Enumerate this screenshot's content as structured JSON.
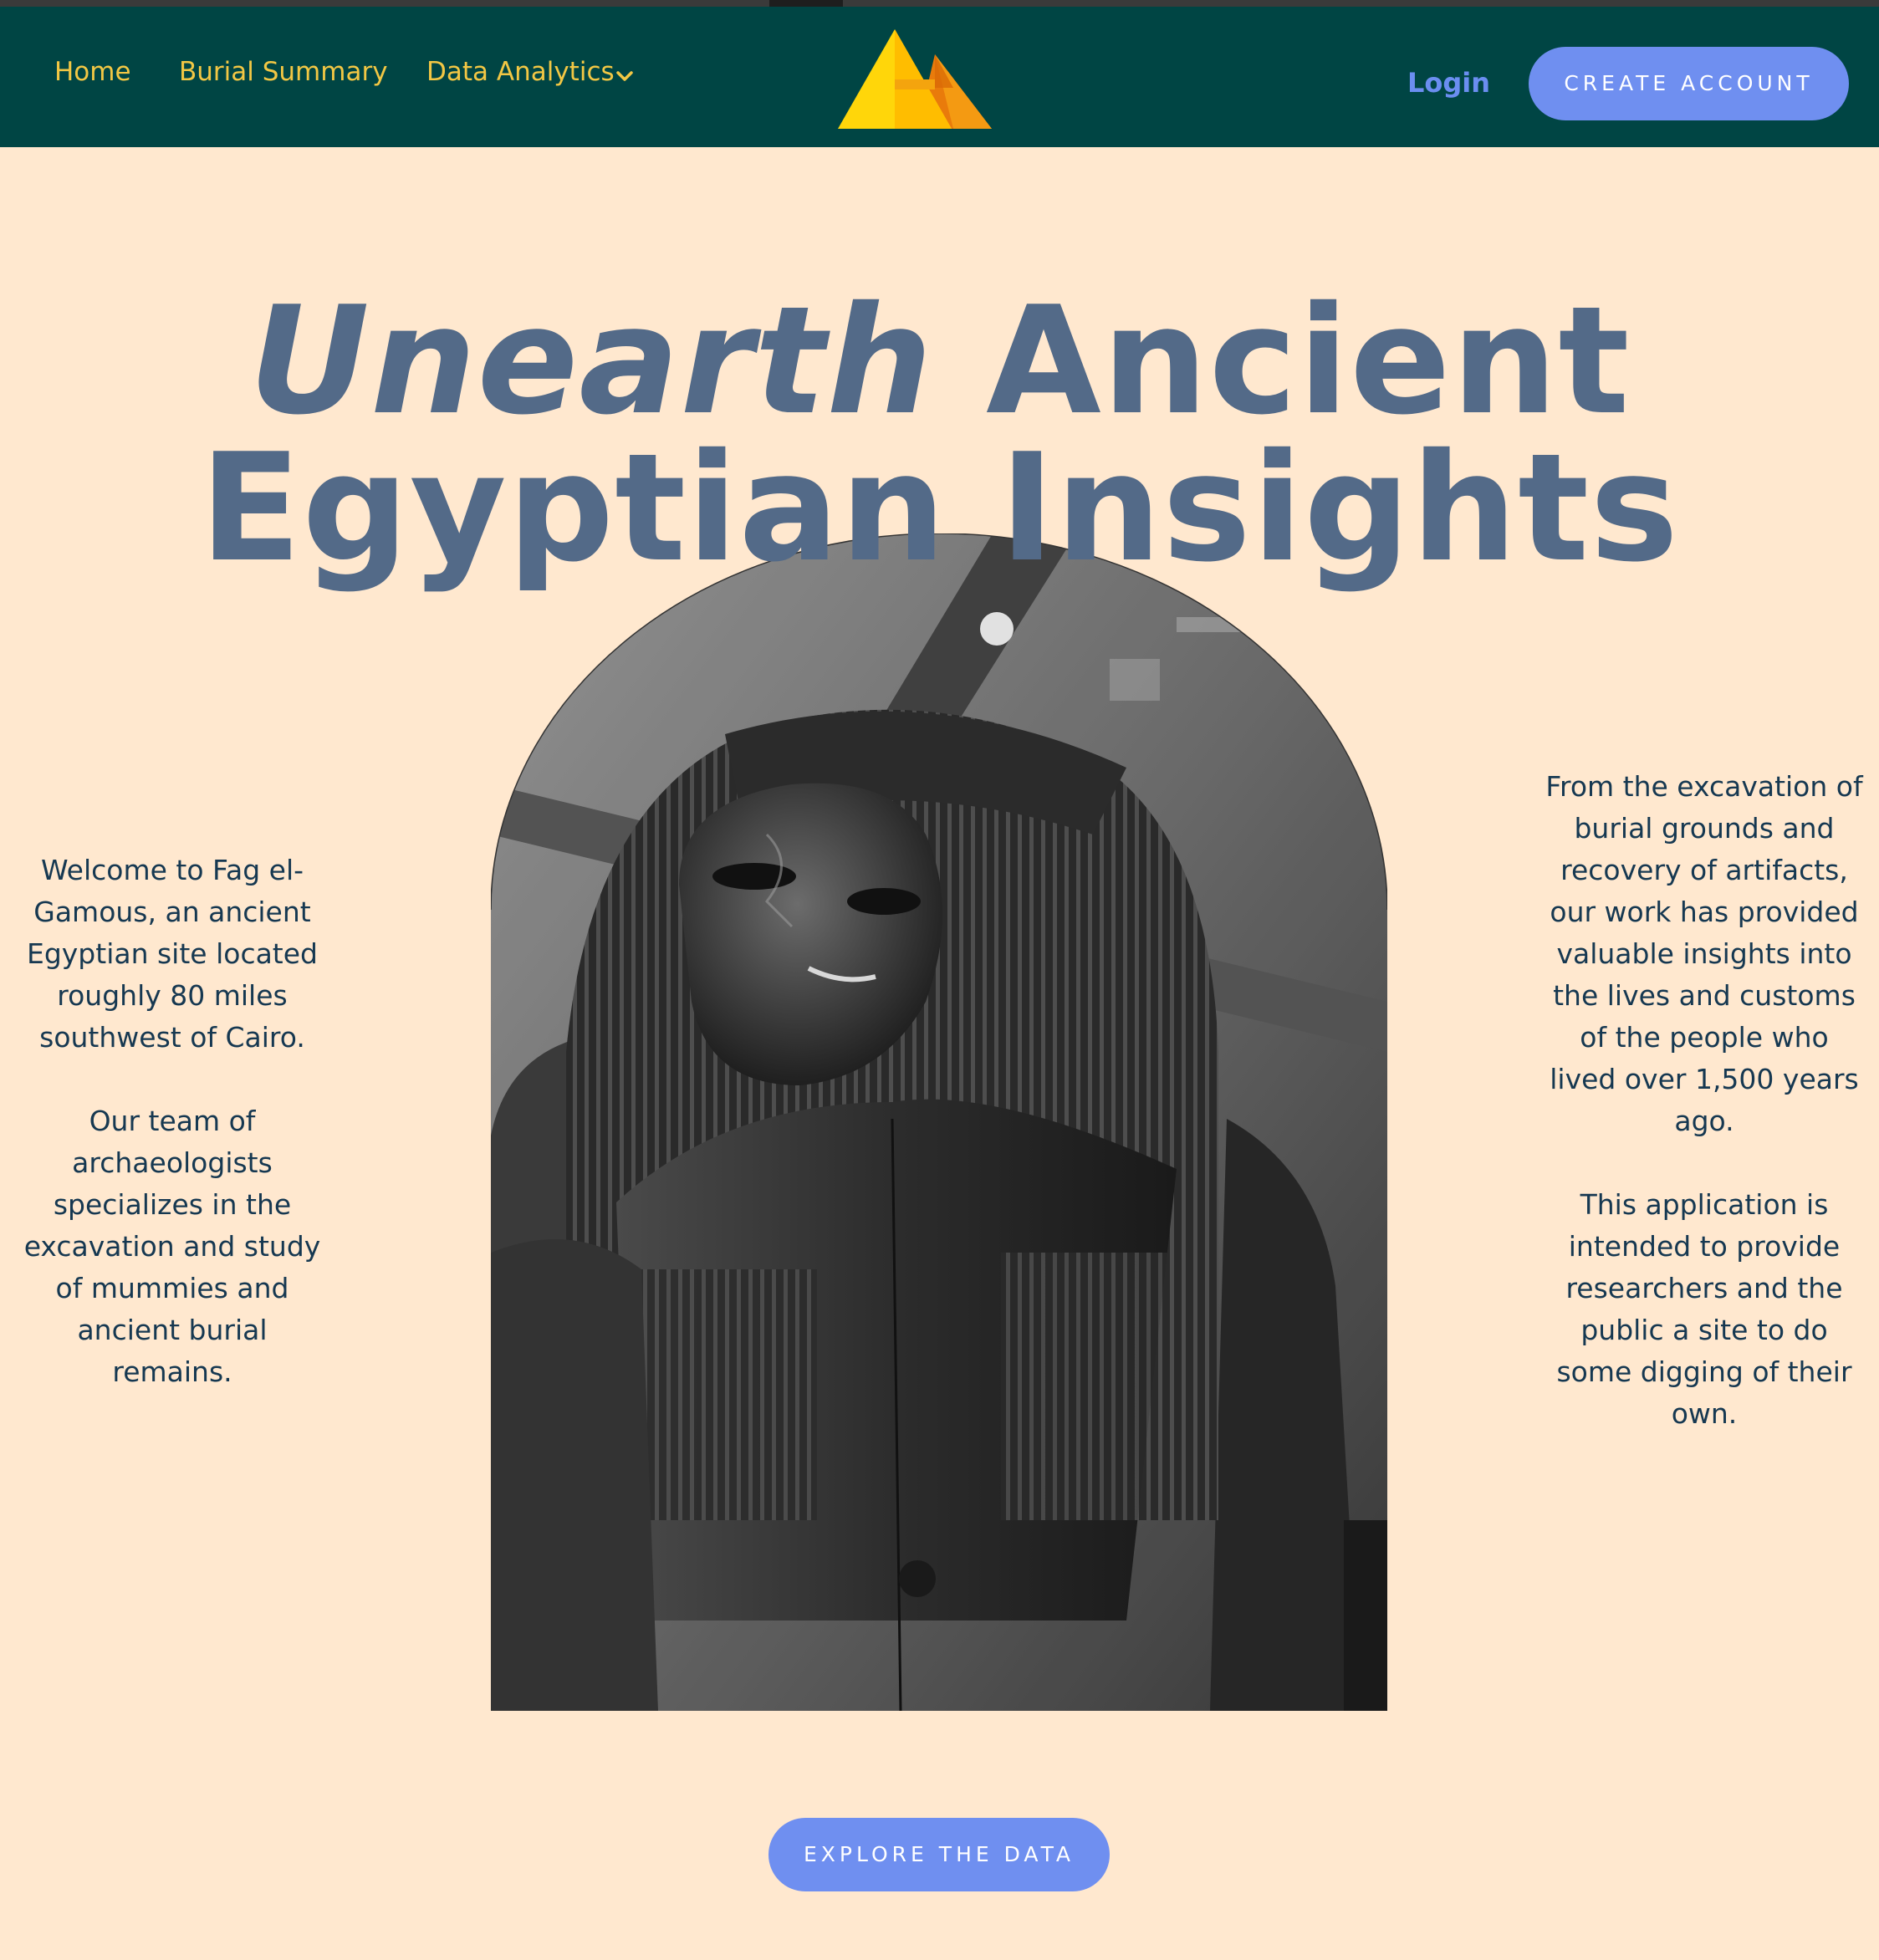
{
  "nav": {
    "home": "Home",
    "burial_summary": "Burial Summary",
    "data_analytics": "Data Analytics",
    "login": "Login",
    "create_account": "CREATE ACCOUNT"
  },
  "logo": {
    "icon": "pyramids-logo-icon",
    "colors": [
      "#ffd60a",
      "#ffbd00",
      "#f48c06",
      "#e85d04"
    ]
  },
  "hero": {
    "headline_italic": "Unearth",
    "headline_rest_line1": "Ancient",
    "headline_line2": "Egyptian Insights",
    "image": "sarcophagus-photo"
  },
  "left_column": {
    "paragraph1": "Welcome to Fag el-Gamous, an ancient Egyptian site located roughly 80 miles southwest of Cairo.",
    "paragraph2": "Our team of archaeologists specializes in the excavation and study of mummies and ancient burial remains."
  },
  "right_column": {
    "paragraph1": "From the excavation of burial grounds and recovery of artifacts, our work has provided valuable insights into the lives and customs of the people who lived over 1,500 years ago.",
    "paragraph2": "This application is intended to provide researchers and the public a site to do some digging of their own."
  },
  "cta": {
    "explore": "EXPLORE THE DATA"
  },
  "colors": {
    "nav_bg": "#004544",
    "nav_link": "#f2c744",
    "page_bg": "#ffe8cf",
    "headline": "#536a88",
    "button": "#6f8ff0",
    "body_text": "#163851"
  }
}
